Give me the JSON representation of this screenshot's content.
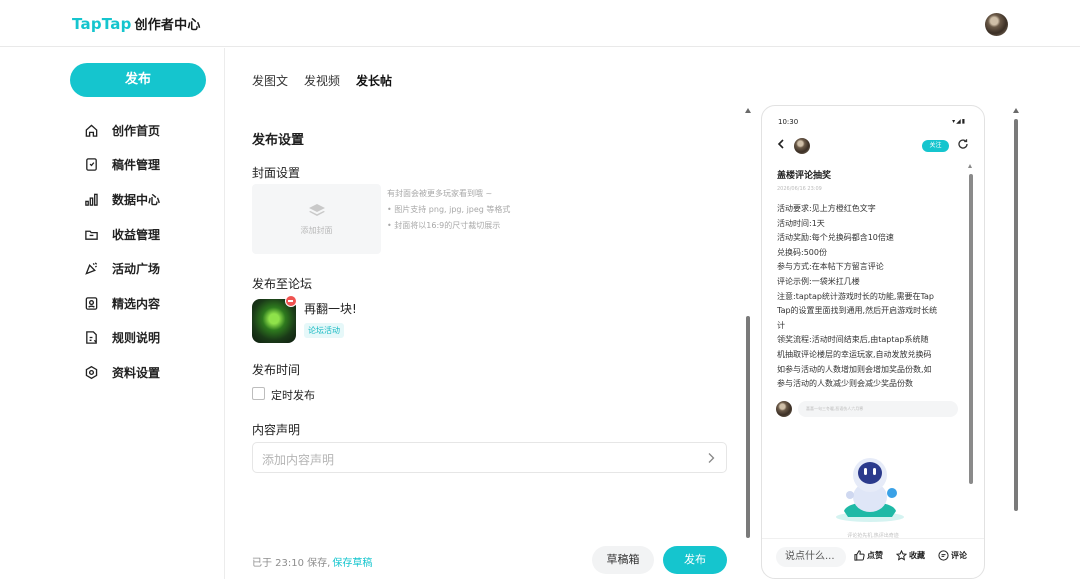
{
  "header": {
    "logo_brand": "TapTap",
    "logo_suffix": "创作者中心"
  },
  "sidebar": {
    "publish_label": "发布",
    "items": [
      {
        "label": "创作首页",
        "icon": "home-icon"
      },
      {
        "label": "稿件管理",
        "icon": "document-icon"
      },
      {
        "label": "数据中心",
        "icon": "bar-chart-icon"
      },
      {
        "label": "收益管理",
        "icon": "folder-icon"
      },
      {
        "label": "活动广场",
        "icon": "party-icon"
      },
      {
        "label": "精选内容",
        "icon": "badge-icon"
      },
      {
        "label": "规则说明",
        "icon": "rules-icon"
      },
      {
        "label": "资料设置",
        "icon": "settings-icon"
      }
    ]
  },
  "tabs": [
    {
      "label": "发图文",
      "active": false
    },
    {
      "label": "发视频",
      "active": false
    },
    {
      "label": "发长帖",
      "active": true
    }
  ],
  "form": {
    "section_title": "发布设置",
    "cover_label": "封面设置",
    "cover_add": "添加封面",
    "cover_tips": [
      "有封面会被更多玩家看到哦 ~",
      "• 图片支持 png, jpg, jpeg 等格式",
      "• 封面将以16:9的尺寸裁切展示"
    ],
    "forum_label": "发布至论坛",
    "forum_name": "再翻一块!",
    "forum_tag": "论坛活动",
    "time_label": "发布时间",
    "scheduled_label": "定时发布",
    "statement_label": "内容声明",
    "statement_placeholder": "添加内容声明"
  },
  "footer": {
    "save_info": "已于 23:10 保存,",
    "save_draft_link": "保存草稿",
    "draft_box": "草稿箱",
    "publish": "发布"
  },
  "preview": {
    "status_time": "10:30",
    "status_icons": "▾◢▮",
    "follow": "关注",
    "title": "盖楼评论抽奖",
    "date": "2026/06/16 23:09",
    "body_lines": [
      "活动要求:见上方橙红色文字",
      "活动时间:1天",
      "活动奖励:每个兑换码都含10倍速",
      "兑换码:500份",
      "参与方式:在本帖下方留言评论",
      "评论示例:一袋米扛几楼",
      "注意:taptap统计游戏时长的功能,需要在Tap",
      "Tap的设置里面找到通用,然后开启游戏时长统",
      "计",
      "领奖流程:活动时间结束后,由taptap系统随",
      "机抽取评论楼层的幸运玩家,自动发放兑换码",
      "如参与活动的人数增加则会增加奖品份数,如",
      "参与活动的人数减少则会减少奖品份数"
    ],
    "comment_placeholder": "喜喜一句三冬暖,恶语伤人六月寒",
    "empty_tip": "评论抢先机,热评出奇迹",
    "say_placeholder": "说点什么...",
    "like": "点赞",
    "collect": "收藏",
    "comment": "评论"
  },
  "colors": {
    "accent": "#15c5ce",
    "badge_red": "#ef5350"
  }
}
